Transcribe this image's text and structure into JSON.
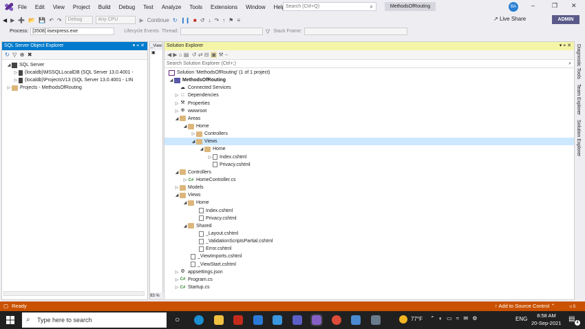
{
  "menu": {
    "items": [
      "File",
      "Edit",
      "View",
      "Project",
      "Build",
      "Debug",
      "Test",
      "Analyze",
      "Tools",
      "Extensions",
      "Window",
      "Help"
    ],
    "search_placeholder": "Search (Ctrl+Q)",
    "project_name": "MethodsOfRouting",
    "avatar_initials": "BA"
  },
  "toolbar": {
    "config": "Debug",
    "platform": "Any CPU",
    "continue_label": "Continue",
    "live_share": "Live Share",
    "admin_badge": "ADMIN",
    "process_label": "Process:",
    "process_value": "[3508] iisexpress.exe",
    "lifecycle_label": "Lifecycle Events",
    "thread_label": "Thread:",
    "stackframe_label": "Stack Frame:"
  },
  "sql_explorer": {
    "title": "SQL Server Object Explorer",
    "items": [
      {
        "label": "SQL Server",
        "icon": "server-group-icon"
      },
      {
        "label": "(localdb)\\MSSQLLocalDB (SQL Server 13.0.4001 -",
        "icon": "server-icon"
      },
      {
        "label": "(localdb)\\ProjectsV13 (SQL Server 13.0.4001 - LIN",
        "icon": "server-icon"
      },
      {
        "label": "Projects - MethodsOfRouting",
        "icon": "folder-icon"
      }
    ]
  },
  "mid_panel": {
    "tab_label": "_View",
    "zoom": "93 %"
  },
  "solution_explorer": {
    "title": "Solution Explorer",
    "search_placeholder": "Search Solution Explorer (Ctrl+;)",
    "items": [
      "Solution 'MethodsOfRouting' (1 of 1 project)",
      "MethodsOfRouting",
      "Connected Services",
      "Dependencies",
      "Properties",
      "wwwroot",
      "Areas",
      "Home",
      "Controllers",
      "Views",
      "Home",
      "Index.cshtml",
      "Privacy.cshtml",
      "Controllers",
      "HomeController.cs",
      "Models",
      "Views",
      "Home",
      "Index.cshtml",
      "Privacy.cshtml",
      "Shared",
      "_Layout.cshtml",
      "_ValidationScriptsPartial.cshtml",
      "Error.cshtml",
      "_ViewImports.cshtml",
      "_ViewStart.cshtml",
      "appsettings.json",
      "Program.cs",
      "Startup.cs"
    ]
  },
  "side_tabs": [
    "Diagnostic Tools",
    "Team Explorer",
    "Solution Explorer"
  ],
  "status": {
    "left": "Ready",
    "source_control": "Add to Source Control",
    "notifications": "5"
  },
  "taskbar": {
    "search_placeholder": "Type here to search",
    "temperature": "77°F",
    "language": "ENG",
    "time": "8:58 AM",
    "date": "20-Sep-2021",
    "notification_count": "4"
  }
}
